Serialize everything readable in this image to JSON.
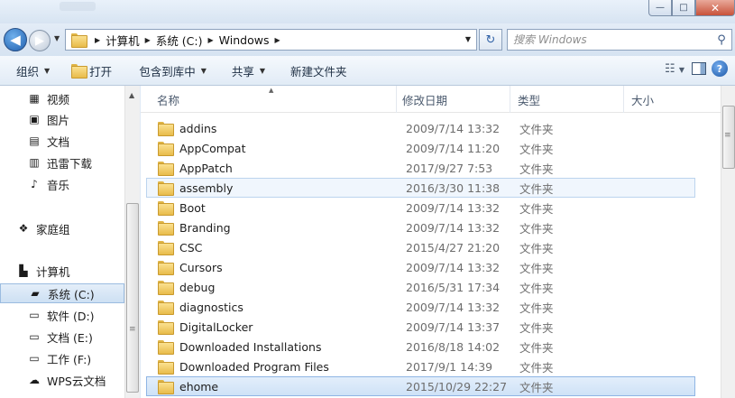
{
  "window": {
    "minimize_icon": "minimize-icon",
    "maximize_icon": "maximize-icon",
    "close_icon": "close-icon",
    "minimize_glyph": "—",
    "maximize_glyph": "□",
    "close_glyph": "✕"
  },
  "address_bar": {
    "back_glyph": "◀",
    "forward_glyph": "▶",
    "crumbs": [
      "计算机",
      "系统 (C:)",
      "Windows"
    ],
    "refresh_glyph": "↻",
    "search_placeholder": "搜索 Windows",
    "search_glyph": "⚲"
  },
  "toolbar": {
    "items": [
      {
        "label": "组织",
        "caret": true
      },
      {
        "label": "打开",
        "caret": false
      },
      {
        "label": "包含到库中",
        "caret": true
      },
      {
        "label": "共享",
        "caret": true
      },
      {
        "label": "新建文件夹",
        "caret": false
      }
    ],
    "help_glyph": "?"
  },
  "nav_pane": {
    "items": [
      {
        "label": "视频",
        "icon": "video-icon",
        "glyph": "▦"
      },
      {
        "label": "图片",
        "icon": "picture-icon",
        "glyph": "▣"
      },
      {
        "label": "文档",
        "icon": "document-icon",
        "glyph": "▤"
      },
      {
        "label": "迅雷下载",
        "icon": "download-folder-icon",
        "glyph": "▥"
      },
      {
        "label": "音乐",
        "icon": "music-icon",
        "glyph": "♪"
      },
      {
        "label": "家庭组",
        "icon": "homegroup-icon",
        "glyph": "❖"
      },
      {
        "label": "计算机",
        "icon": "computer-icon",
        "glyph": "▙"
      },
      {
        "label": "系统 (C:)",
        "icon": "system-drive-icon",
        "glyph": "▰",
        "selected": true
      },
      {
        "label": "软件 (D:)",
        "icon": "drive-icon",
        "glyph": "▭"
      },
      {
        "label": "文档 (E:)",
        "icon": "drive-icon",
        "glyph": "▭"
      },
      {
        "label": "工作 (F:)",
        "icon": "drive-icon",
        "glyph": "▭"
      },
      {
        "label": "WPS云文档",
        "icon": "cloud-icon",
        "glyph": "☁"
      }
    ]
  },
  "columns": {
    "name": "名称",
    "date": "修改日期",
    "type": "类型",
    "size": "大小"
  },
  "files": [
    {
      "name": "addins",
      "date": "2009/7/14 13:32",
      "type": "文件夹"
    },
    {
      "name": "AppCompat",
      "date": "2009/7/14 11:20",
      "type": "文件夹"
    },
    {
      "name": "AppPatch",
      "date": "2017/9/27 7:53",
      "type": "文件夹"
    },
    {
      "name": "assembly",
      "date": "2016/3/30 11:38",
      "type": "文件夹",
      "state": "hl"
    },
    {
      "name": "Boot",
      "date": "2009/7/14 13:32",
      "type": "文件夹"
    },
    {
      "name": "Branding",
      "date": "2009/7/14 13:32",
      "type": "文件夹"
    },
    {
      "name": "CSC",
      "date": "2015/4/27 21:20",
      "type": "文件夹"
    },
    {
      "name": "Cursors",
      "date": "2009/7/14 13:32",
      "type": "文件夹"
    },
    {
      "name": "debug",
      "date": "2016/5/31 17:34",
      "type": "文件夹"
    },
    {
      "name": "diagnostics",
      "date": "2009/7/14 13:32",
      "type": "文件夹"
    },
    {
      "name": "DigitalLocker",
      "date": "2009/7/14 13:37",
      "type": "文件夹"
    },
    {
      "name": "Downloaded Installations",
      "date": "2016/8/18 14:02",
      "type": "文件夹"
    },
    {
      "name": "Downloaded Program Files",
      "date": "2017/9/1 14:39",
      "type": "文件夹"
    },
    {
      "name": "ehome",
      "date": "2015/10/29 22:27",
      "type": "文件夹",
      "state": "sel"
    }
  ]
}
